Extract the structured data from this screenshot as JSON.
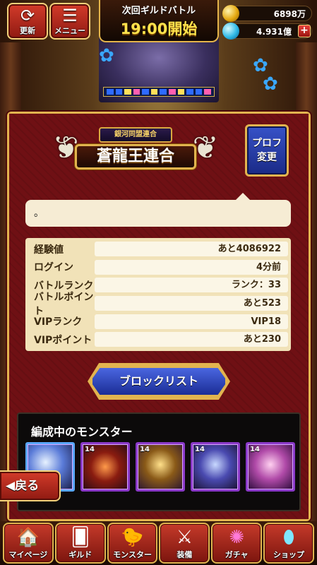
{
  "header": {
    "refresh_label": "更新",
    "menu_label": "メニュー",
    "battle_line1": "次回ギルドバトル",
    "battle_line2": "19:00開始",
    "gold": "6898万",
    "gems": "4.931億",
    "plus": "+"
  },
  "profile": {
    "guild_top": "銀河同盟連合",
    "guild_name": "蒼龍王連合",
    "edit_button": [
      "プロフ",
      "変更"
    ],
    "comment": "。",
    "stats": [
      {
        "label": "経験値",
        "value": "あと4086922"
      },
      {
        "label": "ログイン",
        "value": "4分前"
      },
      {
        "label": "バトルランク",
        "value": "ランク：33"
      },
      {
        "label": "バトルポイント",
        "value": "あと523"
      },
      {
        "label": "VIPランク",
        "value": "VIP18"
      },
      {
        "label": "VIPポイント",
        "value": "あと230"
      }
    ],
    "block_list_label": "ブロックリスト",
    "party_title": "編成中のモンスター",
    "party_levels": [
      "",
      "14",
      "14",
      "14",
      "14"
    ]
  },
  "back_label": "◀戻る",
  "nav": [
    {
      "label": "マイページ",
      "icon": "house-icon"
    },
    {
      "label": "ギルド",
      "icon": "guild-cards-icon"
    },
    {
      "label": "モンスター",
      "icon": "monster-bird-icon"
    },
    {
      "label": "装備",
      "icon": "swords-icon"
    },
    {
      "label": "ガチャ",
      "icon": "gacha-circle-icon"
    },
    {
      "label": "ショップ",
      "icon": "egg-icon"
    }
  ]
}
